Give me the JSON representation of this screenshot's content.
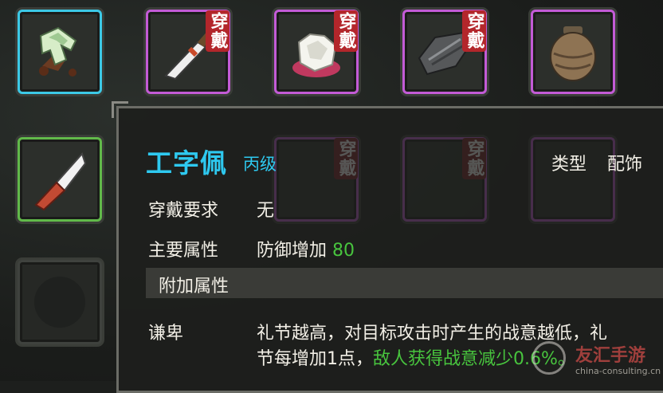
{
  "equip_badge": "穿戴",
  "item": {
    "name": "工字佩",
    "grade": "丙级",
    "type_label": "类型",
    "type_value": "配饰",
    "requirement_label": "穿戴要求",
    "requirement_value": "无",
    "main_attr_label": "主要属性",
    "main_attr_text": "防御增加",
    "main_attr_value": "80",
    "extra_attr_header": "附加属性",
    "skill_name": "谦卑",
    "skill_desc_line1": "礼节越高，对目标攻击时产生的战意越低，礼",
    "skill_desc_line2_white": "节每增加1点，",
    "skill_desc_line2_green": "敌人获得战意减少0.6%。"
  },
  "watermark": {
    "brand": "友汇手游",
    "url": "china-consulting.cn"
  },
  "colors": {
    "rarity_cyan": "#3cc9e6",
    "rarity_purple": "#c35bd6",
    "rarity_green": "#61b94a",
    "badge_red": "#b3262b",
    "name_cyan": "#2ec9f0",
    "buff_green": "#48c43e"
  },
  "slots_top": [
    {
      "icon": "jade-pendant-icon",
      "rarity": "cyan",
      "equipped": false
    },
    {
      "icon": "blade-icon",
      "rarity": "purple",
      "equipped": true
    },
    {
      "icon": "white-fur-icon",
      "rarity": "purple",
      "equipped": true
    },
    {
      "icon": "leather-armor-icon",
      "rarity": "purple",
      "equipped": true
    },
    {
      "icon": "clay-jar-icon",
      "rarity": "purple",
      "equipped": false
    }
  ],
  "slots_left": [
    {
      "icon": "knife-icon",
      "rarity": "green",
      "equipped": false
    },
    {
      "icon": "empty-slot-icon",
      "rarity": "empty",
      "equipped": false
    }
  ]
}
